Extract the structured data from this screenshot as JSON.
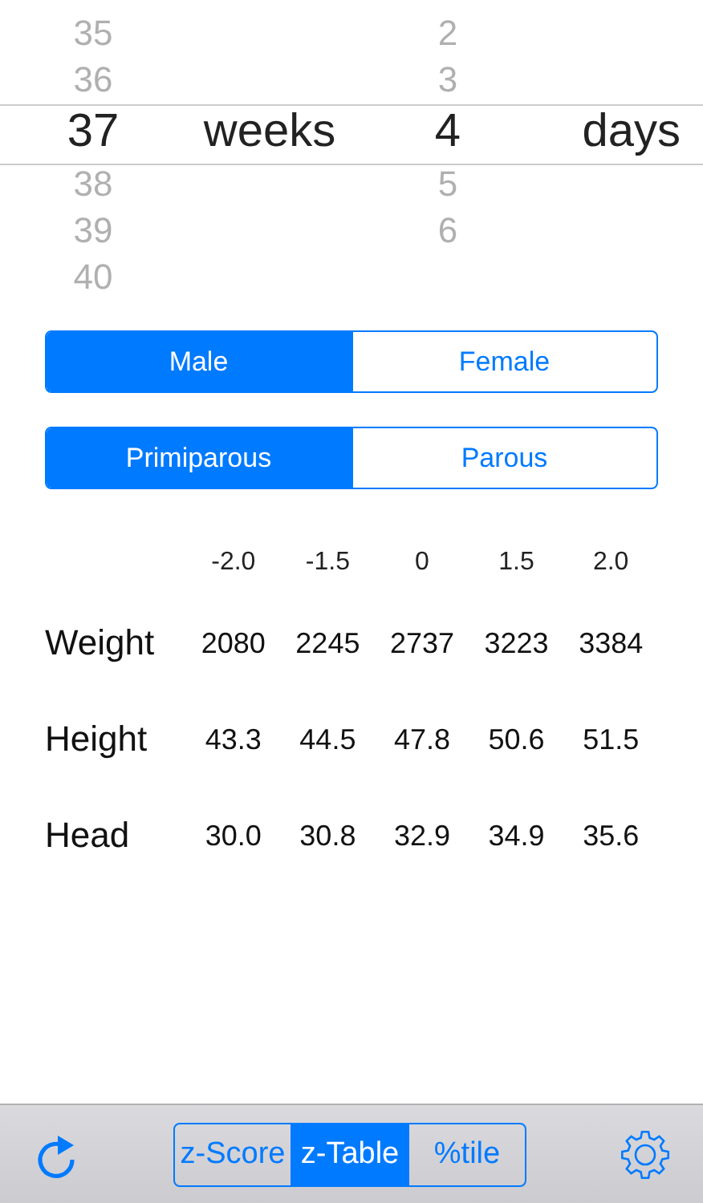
{
  "picker": {
    "weeks": [
      {
        "label": "35",
        "selected": false
      },
      {
        "label": "36",
        "selected": false
      },
      {
        "label": "37",
        "selected": true
      },
      {
        "label": "38",
        "selected": false
      },
      {
        "label": "39",
        "selected": false
      },
      {
        "label": "40",
        "selected": false
      }
    ],
    "weeks_unit": "weeks",
    "days": [
      {
        "label": "2",
        "selected": false
      },
      {
        "label": "3",
        "selected": false
      },
      {
        "label": "4",
        "selected": true
      },
      {
        "label": "5",
        "selected": false
      },
      {
        "label": "6",
        "selected": false
      }
    ],
    "days_unit": "days"
  },
  "sex": [
    {
      "label": "Male",
      "selected": true
    },
    {
      "label": "Female",
      "selected": false
    }
  ],
  "parity": [
    {
      "label": "Primiparous",
      "selected": true
    },
    {
      "label": "Parous",
      "selected": false
    }
  ],
  "table": {
    "columns": [
      "-2.0",
      "-1.5",
      "0",
      "1.5",
      "2.0"
    ],
    "rows": [
      {
        "label": "Weight",
        "values": [
          "2080",
          "2245",
          "2737",
          "3223",
          "3384"
        ]
      },
      {
        "label": "Height",
        "values": [
          "43.3",
          "44.5",
          "47.8",
          "50.6",
          "51.5"
        ]
      },
      {
        "label": "Head",
        "values": [
          "30.0",
          "30.8",
          "32.9",
          "34.9",
          "35.6"
        ]
      }
    ]
  },
  "mode": [
    {
      "label": "z-Score",
      "selected": false
    },
    {
      "label": "z-Table",
      "selected": true
    },
    {
      "label": "%tile",
      "selected": false
    }
  ]
}
